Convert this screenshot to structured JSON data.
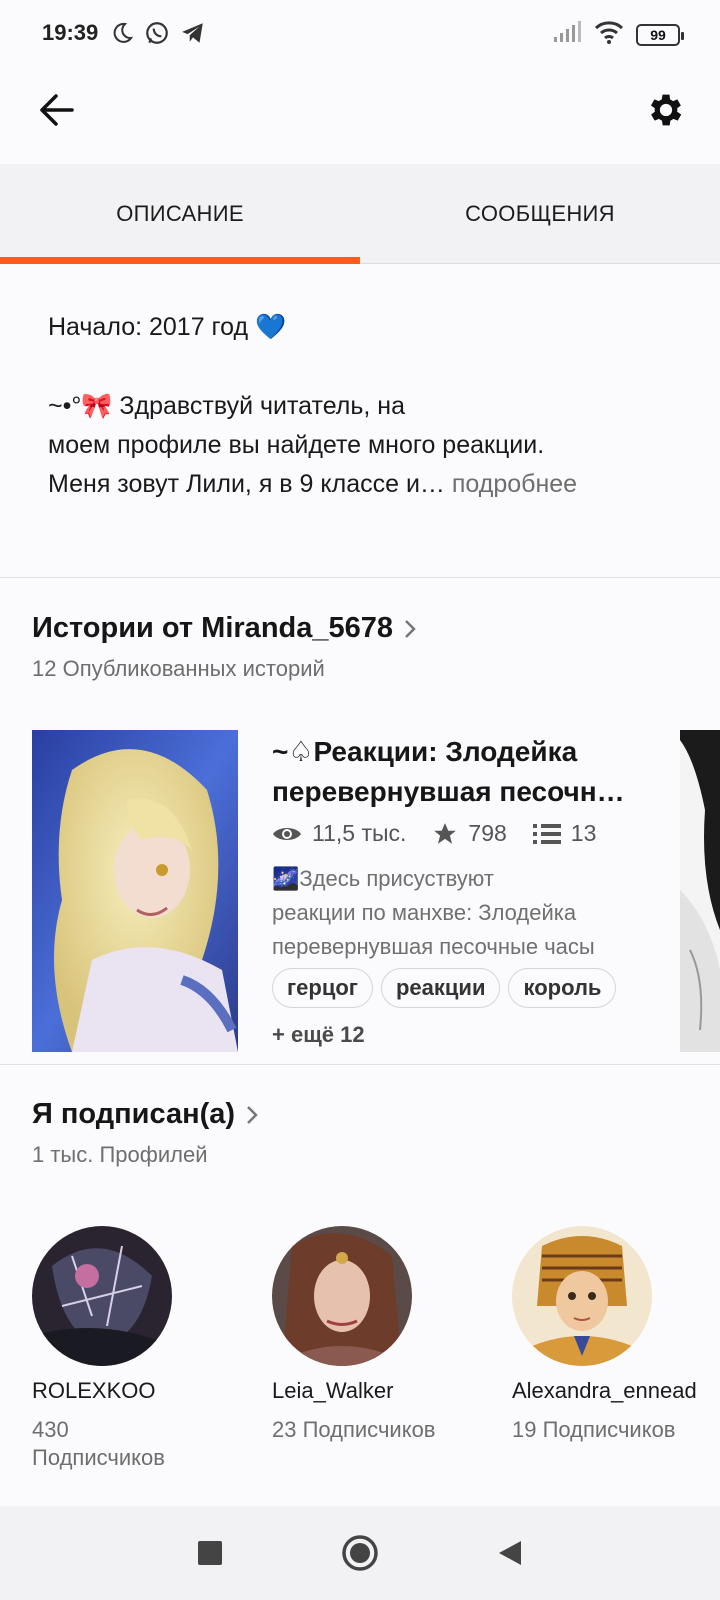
{
  "status_bar": {
    "time": "19:39",
    "battery": "99"
  },
  "tabs": [
    {
      "label": "ОПИСАНИЕ",
      "active": true
    },
    {
      "label": "СООБЩЕНИЯ",
      "active": false
    }
  ],
  "description": {
    "line1": "Начало: 2017 год 💙",
    "line2": "~•°🎀 Здравствуй читатель, на",
    "line3": "моем профиле вы найдете много реакции.",
    "line4": "Меня зовут Лили, я в 9 классе и…",
    "more": " подробнее"
  },
  "stories": {
    "title": "Истории от Miranda_5678",
    "subtitle": "12 Опубликованных историй",
    "items": [
      {
        "title_line1": "~♤Реакции: Злодейка",
        "title_line2": "перевернувшая песочные часы",
        "views": "11,5 тыс.",
        "votes": "798",
        "parts": "13",
        "desc_line1": "🌌Здесь присуствуют",
        "desc_line2": "реакции по манхве: Злодейка",
        "desc_line3": "перевернувшая песочные часы",
        "tags": [
          "герцог",
          "реакции",
          "король"
        ],
        "more_tags": "+ ещё 12"
      }
    ]
  },
  "following": {
    "title": "Я подписан(а)",
    "subtitle": "1 тыс. Профилей",
    "profiles": [
      {
        "name": "ROLEXKOO",
        "followers": "430 Подписчиков"
      },
      {
        "name": "Leia_Walker",
        "followers": "23 Подписчиков"
      },
      {
        "name": "Alexandra_ennead",
        "followers": "19 Подписчиков"
      }
    ]
  },
  "colors": {
    "accent": "#ff5a1f",
    "background": "#fbfafc",
    "tabs_background": "#f2f1f3"
  }
}
